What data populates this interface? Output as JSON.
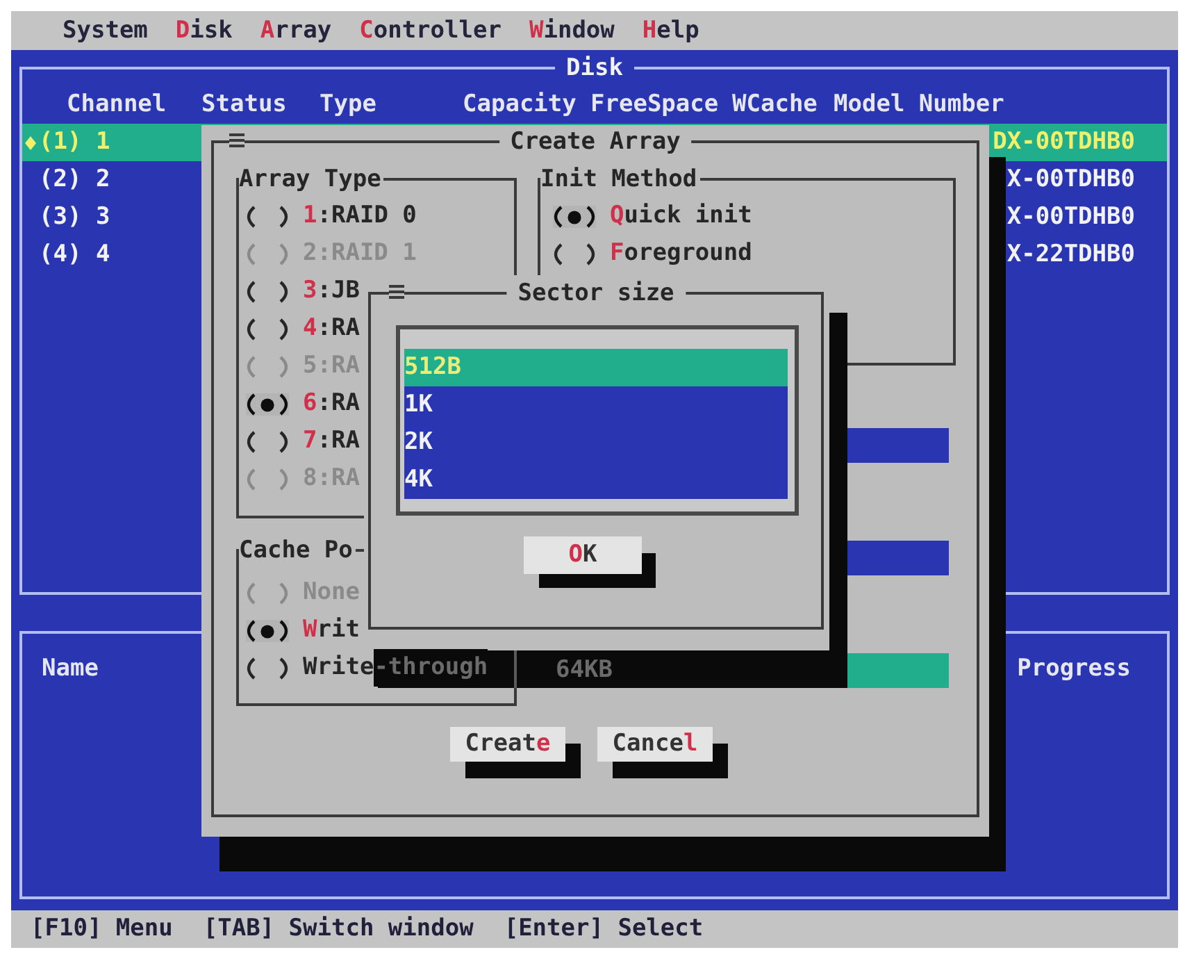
{
  "menu_bar": [
    {
      "label": [
        {
          "text": "System",
          "hotkey": false
        }
      ]
    },
    {
      "label": [
        {
          "text": "D",
          "hotkey": true
        },
        {
          "text": "isk",
          "hotkey": false
        }
      ]
    },
    {
      "label": [
        {
          "text": "A",
          "hotkey": true
        },
        {
          "text": "rray",
          "hotkey": false
        }
      ]
    },
    {
      "label": [
        {
          "text": "C",
          "hotkey": true
        },
        {
          "text": "ontroller",
          "hotkey": false
        }
      ]
    },
    {
      "label": [
        {
          "text": "W",
          "hotkey": true
        },
        {
          "text": "indow",
          "hotkey": false
        }
      ]
    },
    {
      "label": [
        {
          "text": "H",
          "hotkey": true
        },
        {
          "text": "elp",
          "hotkey": false
        }
      ]
    }
  ],
  "disk_panel": {
    "title": "Disk",
    "columns": [
      "Channel",
      "Status",
      "Type",
      "Capacity",
      "FreeSpace",
      "WCache",
      "Model Number"
    ],
    "rows": [
      {
        "channel": "(1) 1",
        "model_number": "DX-00TDHB0",
        "selected": true
      },
      {
        "channel": "(2) 2",
        "model_number": "X-00TDHB0",
        "selected": false
      },
      {
        "channel": "(3) 3",
        "model_number": "X-00TDHB0",
        "selected": false
      },
      {
        "channel": "(4) 4",
        "model_number": "X-22TDHB0",
        "selected": false
      }
    ]
  },
  "array_panel": {
    "columns": [
      "Name",
      "Progress"
    ]
  },
  "create_array_dialog": {
    "title": "Create Array",
    "array_type": {
      "title": "Array Type",
      "options": [
        {
          "label": [
            {
              "text": "1",
              "hotkey": true
            },
            {
              "text": ":RAID 0",
              "hotkey": false
            }
          ],
          "selected": false,
          "disabled": false
        },
        {
          "label": [
            {
              "text": "2:RAID 1",
              "hotkey": false
            }
          ],
          "selected": false,
          "disabled": true
        },
        {
          "label": [
            {
              "text": "3",
              "hotkey": true
            },
            {
              "text": ":JB",
              "hotkey": false
            }
          ],
          "selected": false,
          "disabled": false
        },
        {
          "label": [
            {
              "text": "4",
              "hotkey": true
            },
            {
              "text": ":RA",
              "hotkey": false
            }
          ],
          "selected": false,
          "disabled": false
        },
        {
          "label": [
            {
              "text": "5:RA",
              "hotkey": false
            }
          ],
          "selected": false,
          "disabled": true
        },
        {
          "label": [
            {
              "text": "6",
              "hotkey": true
            },
            {
              "text": ":RA",
              "hotkey": false
            }
          ],
          "selected": true,
          "disabled": false
        },
        {
          "label": [
            {
              "text": "7",
              "hotkey": true
            },
            {
              "text": ":RA",
              "hotkey": false
            }
          ],
          "selected": false,
          "disabled": false
        },
        {
          "label": [
            {
              "text": "8:RA",
              "hotkey": false
            }
          ],
          "selected": false,
          "disabled": true
        }
      ]
    },
    "init_method": {
      "title": "Init Method",
      "options": [
        {
          "label": [
            {
              "text": "Q",
              "hotkey": true
            },
            {
              "text": "uick init",
              "hotkey": false
            }
          ],
          "selected": true,
          "disabled": false
        },
        {
          "label": [
            {
              "text": "F",
              "hotkey": true
            },
            {
              "text": "oreground",
              "hotkey": false
            }
          ],
          "selected": false,
          "disabled": false
        }
      ]
    },
    "fields": [
      {
        "focused": false
      },
      {
        "focused": false
      },
      {
        "focused": true,
        "value": "64KB"
      }
    ],
    "cache_policy": {
      "title": "Cache Po",
      "options": [
        {
          "label": [
            {
              "text": "None",
              "hotkey": false,
              "shadowed": false
            }
          ],
          "selected": false,
          "disabled": true
        },
        {
          "label": [
            {
              "text": "W",
              "hotkey": true,
              "shadowed": false
            },
            {
              "text": "rit",
              "hotkey": false,
              "shadowed": false
            }
          ],
          "selected": true,
          "disabled": false
        },
        {
          "label": [
            {
              "text": "Write",
              "hotkey": false,
              "shadowed": false
            },
            {
              "text": "-through",
              "hotkey": false,
              "shadowed": true
            }
          ],
          "selected": false,
          "disabled": false
        }
      ]
    },
    "buttons": [
      {
        "label": [
          {
            "text": "Creat",
            "hotkey": false
          },
          {
            "text": "e",
            "hotkey": true
          }
        ]
      },
      {
        "label": [
          {
            "text": "Cance",
            "hotkey": false
          },
          {
            "text": "l",
            "hotkey": true
          }
        ]
      }
    ]
  },
  "sector_size_dialog": {
    "title": "Sector size",
    "options": [
      {
        "label": "512B",
        "selected": true
      },
      {
        "label": "1K",
        "selected": false
      },
      {
        "label": "2K",
        "selected": false
      },
      {
        "label": "4K",
        "selected": false
      }
    ],
    "button": {
      "label": [
        {
          "text": "O",
          "hotkey": true
        },
        {
          "text": "K",
          "hotkey": false
        }
      ]
    }
  },
  "status_bar": [
    "[F10] Menu",
    "[TAB] Switch window",
    "[Enter] Select"
  ]
}
